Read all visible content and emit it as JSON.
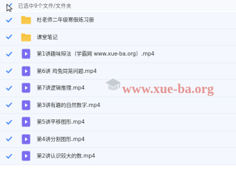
{
  "header": {
    "selection_text": "已选中9个文件/文件夹",
    "checked": true
  },
  "files": [
    {
      "type": "folder",
      "name": "杜老师二年级寒假练习册",
      "checked": true
    },
    {
      "type": "folder",
      "name": "课堂笔记",
      "checked": true
    },
    {
      "type": "video",
      "name": "第1讲趣味辩法（学霸网 www.xue-ba.org）.mp4",
      "checked": true
    },
    {
      "type": "video",
      "name": "第6讲 鸡兔同笼问题.mp4",
      "checked": true
    },
    {
      "type": "video",
      "name": "第7讲逻辑推理.mp4",
      "checked": true
    },
    {
      "type": "video",
      "name": "第3讲有趣的自然数字.mp4",
      "checked": true
    },
    {
      "type": "video",
      "name": "第5讲平移图形.mp4",
      "checked": true
    },
    {
      "type": "video",
      "name": "第4讲分割图形.mp4",
      "checked": true
    },
    {
      "type": "video",
      "name": "第2讲认识较大的数.mp4",
      "checked": true
    }
  ],
  "watermark": {
    "text": "www.xue-ba.org"
  },
  "colors": {
    "accent": "#3b86f7",
    "folder": "#f9c84a",
    "video": "#7a6cf0"
  }
}
